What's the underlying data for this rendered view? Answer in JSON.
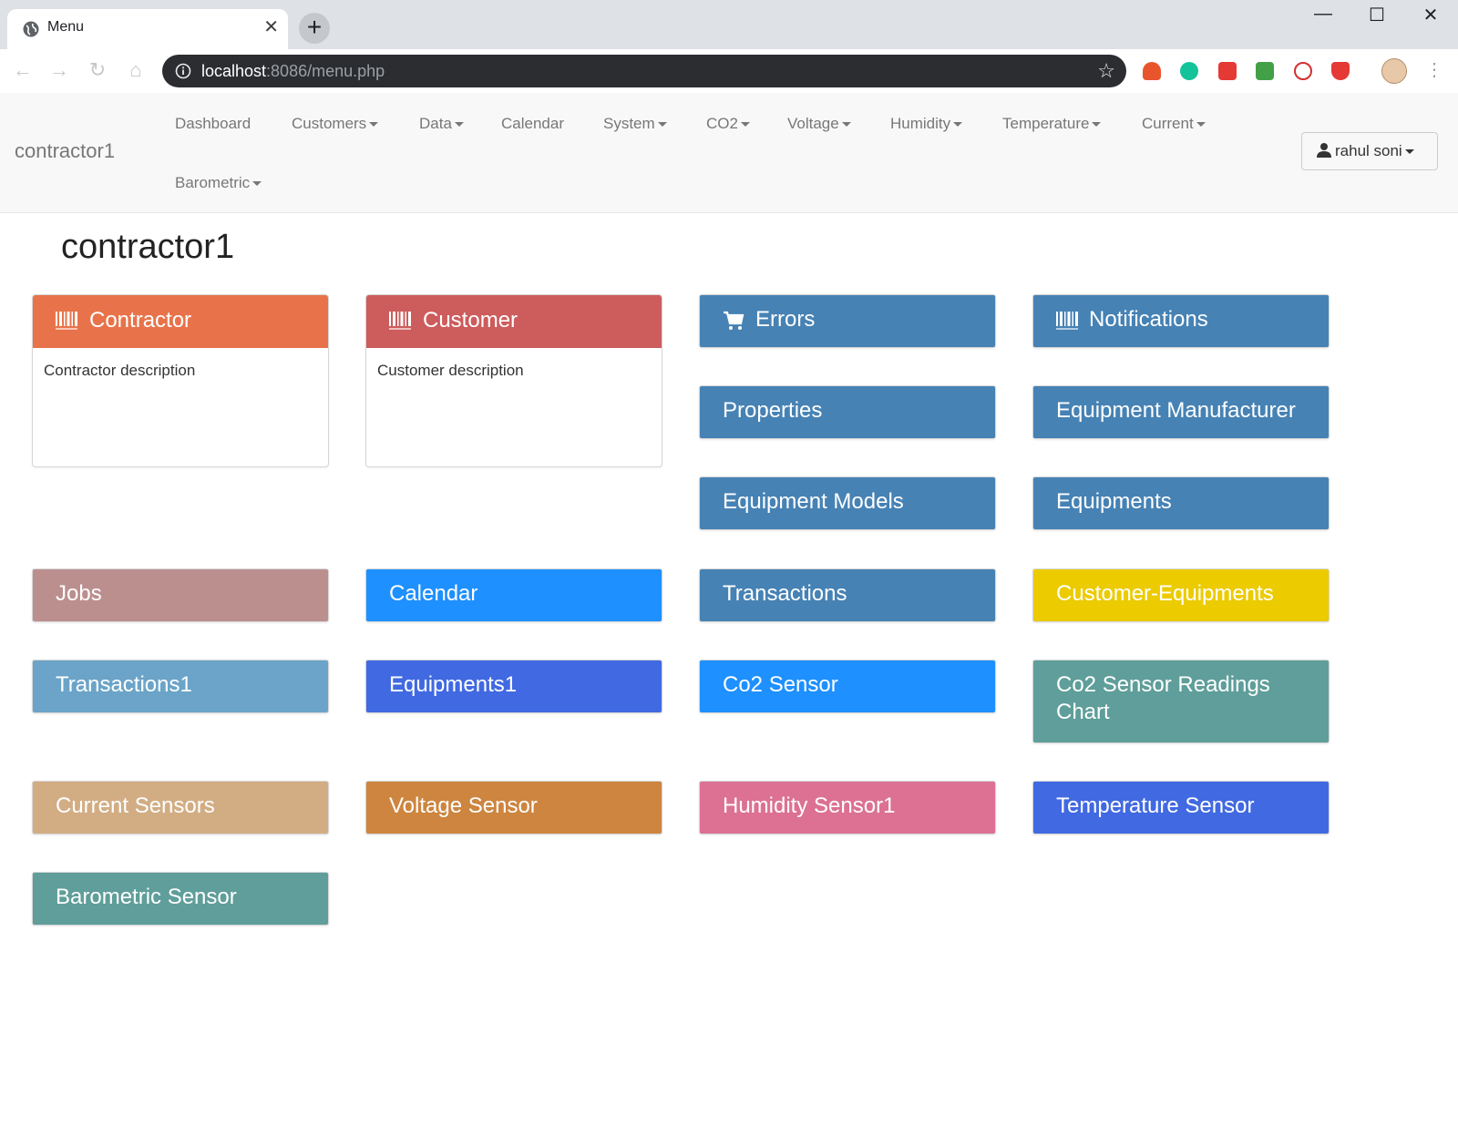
{
  "browser": {
    "tab_title": "Menu",
    "tab_close": "✕",
    "new_tab": "+",
    "window_controls": {
      "minimize": "—",
      "maximize": "☐",
      "close": "✕"
    },
    "url_host": "localhost",
    "url_rest": ":8086/menu.php",
    "bookmark_icon": "☆"
  },
  "navbar": {
    "brand": "contractor1",
    "items": [
      {
        "label": "Dashboard"
      },
      {
        "label": "Customers"
      },
      {
        "label": "Data"
      },
      {
        "label": "Calendar"
      },
      {
        "label": "System"
      },
      {
        "label": "CO2"
      },
      {
        "label": "Voltage"
      },
      {
        "label": "Humidity"
      },
      {
        "label": "Temperature"
      },
      {
        "label": "Current"
      },
      {
        "label": "Barometric"
      }
    ],
    "user": "rahul soni"
  },
  "page": {
    "title": "contractor1",
    "cards": [
      {
        "title": "Contractor",
        "description": "Contractor description",
        "color": "#e8734a",
        "icon": "barcode-icon"
      },
      {
        "title": "Customer",
        "description": "Customer description",
        "color": "#cd5c5c",
        "icon": "barcode-icon"
      }
    ],
    "tiles": [
      {
        "label": "Errors",
        "color": "#4682b4",
        "icon": "cart-icon"
      },
      {
        "label": "Notifications",
        "color": "#4682b4",
        "icon": "barcode-icon"
      },
      {
        "label": "Properties",
        "color": "#4682b4"
      },
      {
        "label": "Equipment Manufacturer",
        "color": "#4682b4"
      },
      {
        "label": "Equipment Models",
        "color": "#4682b4"
      },
      {
        "label": "Equipments",
        "color": "#4682b4"
      },
      {
        "label": "Jobs",
        "color": "#bc8f8f"
      },
      {
        "label": "Calendar",
        "color": "#1e90ff"
      },
      {
        "label": "Transactions",
        "color": "#4682b4"
      },
      {
        "label": "Customer-Equipments",
        "color": "#eccb00"
      },
      {
        "label": "Transactions1",
        "color": "#6ba4c8"
      },
      {
        "label": "Equipments1",
        "color": "#4169e1"
      },
      {
        "label": "Co2 Sensor",
        "color": "#1e90ff"
      },
      {
        "label": "Co2 Sensor Readings Chart",
        "color": "#5f9e9a"
      },
      {
        "label": "Current Sensors",
        "color": "#d2ad84"
      },
      {
        "label": "Voltage Sensor",
        "color": "#cd853f"
      },
      {
        "label": "Humidity Sensor1",
        "color": "#dc7193"
      },
      {
        "label": "Temperature Sensor",
        "color": "#4169e1"
      },
      {
        "label": "Barometric Sensor",
        "color": "#5f9e9a"
      }
    ]
  }
}
